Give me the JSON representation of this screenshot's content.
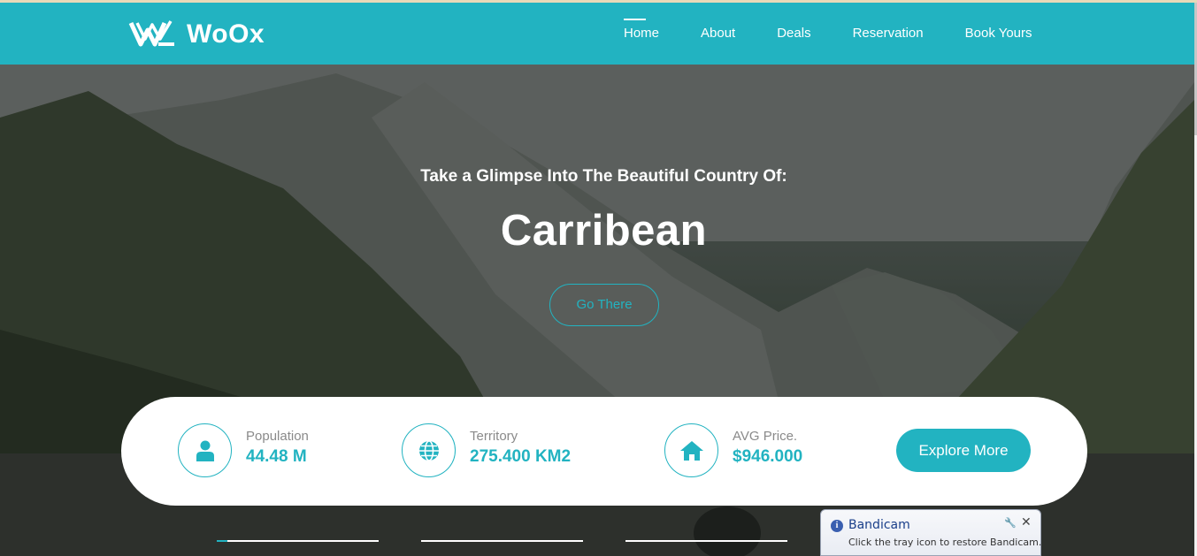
{
  "brand": {
    "name": "WoOx",
    "accent": "#22b3c1"
  },
  "nav": {
    "items": [
      {
        "label": "Home",
        "active": true
      },
      {
        "label": "About",
        "active": false
      },
      {
        "label": "Deals",
        "active": false
      },
      {
        "label": "Reservation",
        "active": false
      },
      {
        "label": "Book Yours",
        "active": false
      }
    ]
  },
  "hero": {
    "subtitle": "Take a Glimpse Into The Beautiful Country Of:",
    "title": "Carribean",
    "cta_label": "Go There"
  },
  "stats": {
    "items": [
      {
        "label": "Population",
        "value": "44.48 M",
        "icon": "user-icon"
      },
      {
        "label": "Territory",
        "value": "275.400 KM2",
        "icon": "globe-icon"
      },
      {
        "label": "AVG Price.",
        "value": "$946.000",
        "icon": "home-icon"
      }
    ],
    "explore_label": "Explore More"
  },
  "slider": {
    "active_index": 0
  },
  "toast": {
    "title": "Bandicam",
    "message": "Click the tray icon to restore Bandicam."
  }
}
